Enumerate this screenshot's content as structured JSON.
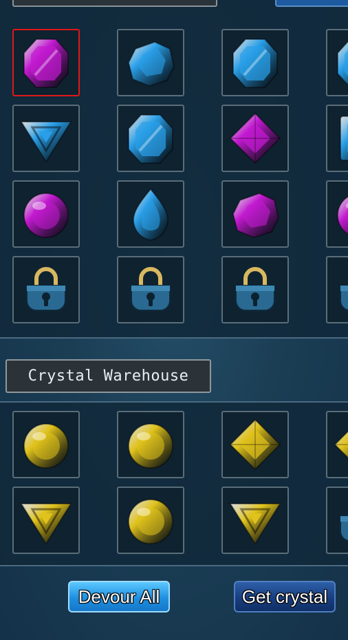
{
  "warehouse": {
    "title": "Crystal Warehouse"
  },
  "actions": {
    "devour_all": "Devour All",
    "get_crystal": "Get crystal"
  },
  "colors": {
    "purple": "#c21ad0",
    "blue": "#2a9fe8",
    "gold": "#e0c21c",
    "selected_border": "#e01818"
  },
  "inventory": [
    {
      "icon": "purple-octagon-gem-icon",
      "selected": true
    },
    {
      "icon": "blue-rough-crystal-icon",
      "selected": false
    },
    {
      "icon": "blue-octagon-gem-icon",
      "selected": false
    },
    {
      "icon": "blue-gem-icon",
      "selected": false
    },
    {
      "icon": "blue-triangle-gem-icon",
      "selected": false
    },
    {
      "icon": "blue-octagon-gem-icon",
      "selected": false
    },
    {
      "icon": "purple-diamond-gem-icon",
      "selected": false
    },
    {
      "icon": "blue-square-gem-icon",
      "selected": false
    },
    {
      "icon": "purple-round-gem-icon",
      "selected": false
    },
    {
      "icon": "blue-teardrop-gem-icon",
      "selected": false
    },
    {
      "icon": "purple-rough-crystal-icon",
      "selected": false
    },
    {
      "icon": "purple-round-gem-icon",
      "selected": false
    },
    {
      "icon": "lock-icon",
      "selected": false
    },
    {
      "icon": "lock-icon",
      "selected": false
    },
    {
      "icon": "lock-icon",
      "selected": false
    },
    {
      "icon": "lock-icon",
      "selected": false
    }
  ],
  "warehouse_items": [
    {
      "icon": "gold-round-gem-icon"
    },
    {
      "icon": "gold-round-gem-icon"
    },
    {
      "icon": "gold-diamond-gem-icon"
    },
    {
      "icon": "gold-diamond-gem-icon"
    },
    {
      "icon": "gold-triangle-gem-icon"
    },
    {
      "icon": "gold-round-gem-icon"
    },
    {
      "icon": "gold-triangle-gem-icon"
    },
    {
      "icon": "lock-icon"
    }
  ]
}
